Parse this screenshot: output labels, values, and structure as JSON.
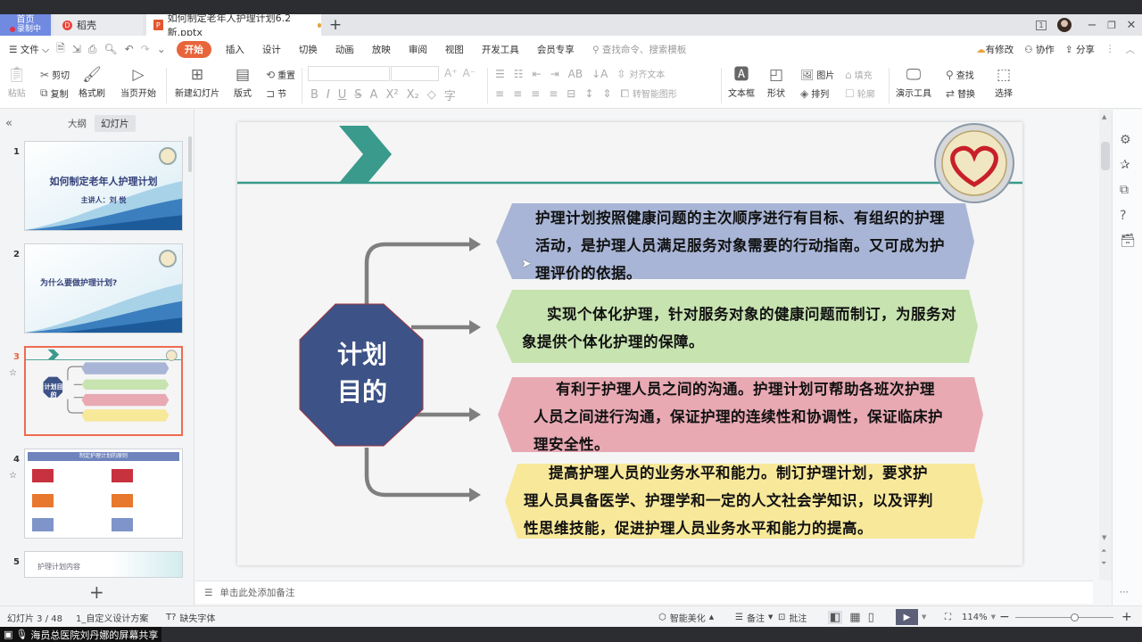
{
  "app": {
    "tabs": {
      "home": {
        "label": "首页",
        "recording": "录制中"
      },
      "daoke": {
        "label": "稻壳"
      },
      "document": {
        "label": "如何制定老年人护理计划6.2新.pptx",
        "modified": true
      }
    },
    "window_controls": {
      "tab_count": "1"
    }
  },
  "menu": {
    "file": "文件",
    "items": [
      "开始",
      "插入",
      "设计",
      "切换",
      "动画",
      "放映",
      "审阅",
      "视图",
      "开发工具",
      "会员专享"
    ],
    "active": "开始",
    "search_placeholder": "查找命令、搜索模板",
    "right": {
      "modified": "有修改",
      "collab": "协作",
      "share": "分享"
    }
  },
  "ribbon": {
    "paste": "粘贴",
    "cut": "剪切",
    "copy": "复制",
    "format_painter": "格式刷",
    "play_from_current": "当页开始",
    "new_slide": "新建幻灯片",
    "layout": "版式",
    "reset": "重置",
    "section": "节",
    "align_text": "对齐文本",
    "smart_art": "转智能图形",
    "textbox": "文本框",
    "shape": "形状",
    "picture": "图片",
    "fill": "填充",
    "arrange": "排列",
    "outline": "轮廓",
    "presenter_tools": "演示工具",
    "find": "查找",
    "replace": "替换",
    "select": "选择"
  },
  "left_panel": {
    "tabs": {
      "outline": "大纲",
      "slides": "幻灯片"
    },
    "thumbnails": [
      {
        "num": "1",
        "title": "如何制定老年人护理计划",
        "subtitle": "主讲人：刘  悦"
      },
      {
        "num": "2",
        "title": "为什么要做护理计划?"
      },
      {
        "num": "3",
        "center": "计划目的",
        "selected": true,
        "starred": true
      },
      {
        "num": "4",
        "title": "制定护理计划的原则",
        "starred": true
      },
      {
        "num": "5",
        "title": "护理计划内容"
      }
    ]
  },
  "slide": {
    "center_label_line1": "计划",
    "center_label_line2": "目的",
    "boxes": [
      {
        "color": "#a8b5d6",
        "lines": [
          "护理计划按照健康问题的主次顺序进行有目标、有组织的护理",
          "活动，是护理人员满足服务对象需要的行动指南。又可成为护",
          "理评价的依据。"
        ]
      },
      {
        "color": "#c7e3b0",
        "lines": [
          "实现个体化护理，针对服务对象的健康问题而制订，为服务对",
          "象提供个体化护理的保障。"
        ]
      },
      {
        "color": "#e8a9b3",
        "lines": [
          "有利于护理人员之间的沟通。护理计划可帮助各班次护理",
          "人员之间进行沟通，保证护理的连续性和协调性，保证临床护",
          "理安全性。"
        ]
      },
      {
        "color": "#f8e89a",
        "lines": [
          "提高护理人员的业务水平和能力。制订护理计划，要求护",
          "理人员具备医学、护理学和一定的人文社会学知识，以及评判",
          "性思维技能，促进护理人员业务水平和能力的提高。"
        ]
      }
    ],
    "colors": {
      "accent_teal": "#3a9a8c",
      "octagon": "#3d5286",
      "arrow": "#7f7f7f"
    }
  },
  "notes": {
    "placeholder": "单击此处添加备注"
  },
  "status": {
    "slide_counter": "幻灯片 3 / 48",
    "theme": "1_自定义设计方案",
    "missing_font": "缺失字体",
    "beautify": "智能美化",
    "notes": "备注",
    "comment": "批注",
    "zoom": "114%",
    "zoom_slider_percent": 60
  },
  "screen_share": {
    "label": "海员总医院刘丹娜的屏幕共享"
  }
}
